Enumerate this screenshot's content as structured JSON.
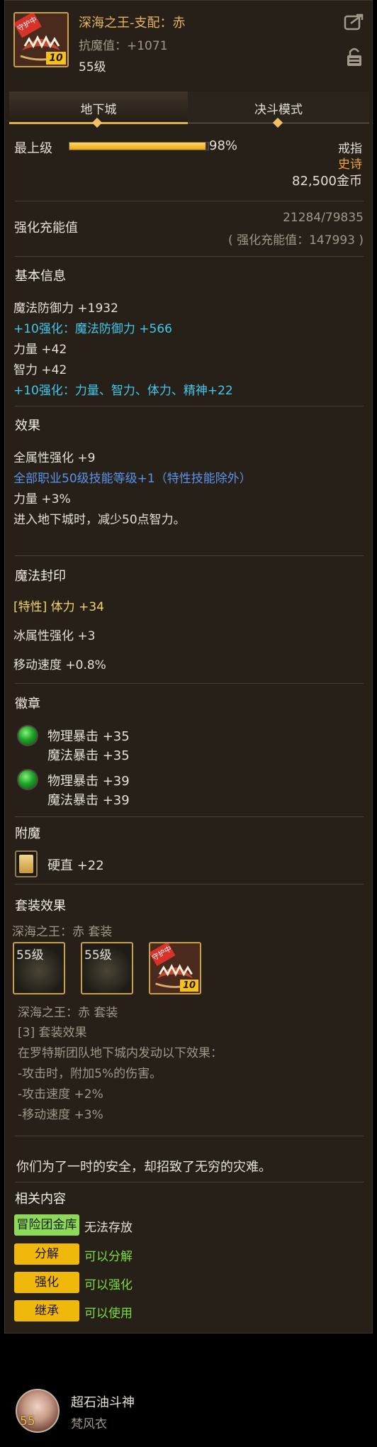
{
  "item": {
    "name": "深海之王-支配：赤",
    "resistance": "抗魔值：+1071",
    "level": "55级",
    "icon_badge": "守护中",
    "icon_level": "10"
  },
  "tabs": [
    "地下城",
    "决斗模式"
  ],
  "top_level": {
    "label": "最上级",
    "progress": 0.98,
    "percent_text": "98%"
  },
  "meta": {
    "slot": "戒指",
    "rarity": "史诗",
    "price": "82,500金币"
  },
  "charge": {
    "label": "强化充能值",
    "progress_text": "21284/79835",
    "value_text": "( 强化充能值：147993 )"
  },
  "basic": {
    "title": "基本信息",
    "lines": [
      "魔法防御力 +1932",
      "+10强化：魔法防御力 +566",
      "力量 +42",
      "智力 +42",
      "+10强化：力量、智力、体力、精神+22"
    ]
  },
  "effect": {
    "title": "效果",
    "lines": [
      "全属性强化 +9",
      "全部职业50级技能等级+1（特性技能除外）",
      "力量 +3%",
      "进入地下城时，减少50点智力。"
    ]
  },
  "seal": {
    "title": "魔法封印",
    "lines": [
      "[特性] 体力 +34",
      "冰属性强化 +3",
      "移动速度 +0.8%"
    ]
  },
  "emblem": {
    "title": "徽章",
    "items": [
      {
        "line1": "物理暴击 +35",
        "line2": "魔法暴击 +35"
      },
      {
        "line1": "物理暴击 +39",
        "line2": "魔法暴击 +39"
      }
    ]
  },
  "enchant": {
    "title": "附魔",
    "value": "硬直 +22"
  },
  "set": {
    "title": "套装效果",
    "subtitle": "深海之王：赤 套装",
    "icon_levels": [
      "55级",
      "55级"
    ],
    "desc_title": "深海之王：赤 套装",
    "lines": [
      "[3] 套装效果",
      "在罗特斯团队地下城内发动以下效果：",
      "-攻击时，附加5%的伤害。",
      "-攻击速度 +2%",
      "-移动速度 +3%"
    ]
  },
  "flavor": "你们为了一时的安全，却招致了无穷的灾难。",
  "related": {
    "title": "相关内容",
    "rows": [
      {
        "tag": "冒险团金库",
        "text": "无法存放",
        "text_color": "#e3e0d6"
      },
      {
        "tag": "分解",
        "text": "可以分解",
        "text_color": "#7ddb3c"
      },
      {
        "tag": "强化",
        "text": "可以强化",
        "text_color": "#7ddb3c"
      },
      {
        "tag": "继承",
        "text": "可以使用",
        "text_color": "#7ddb3c"
      }
    ]
  },
  "character": {
    "name": "超石油斗神",
    "job": "梵风衣",
    "level": "55"
  },
  "colors": {
    "accent_gold": "#e7b45e",
    "cyan": "#43c8e9",
    "green": "#7ddb3c",
    "tag_yellow": "#f1b80c"
  }
}
